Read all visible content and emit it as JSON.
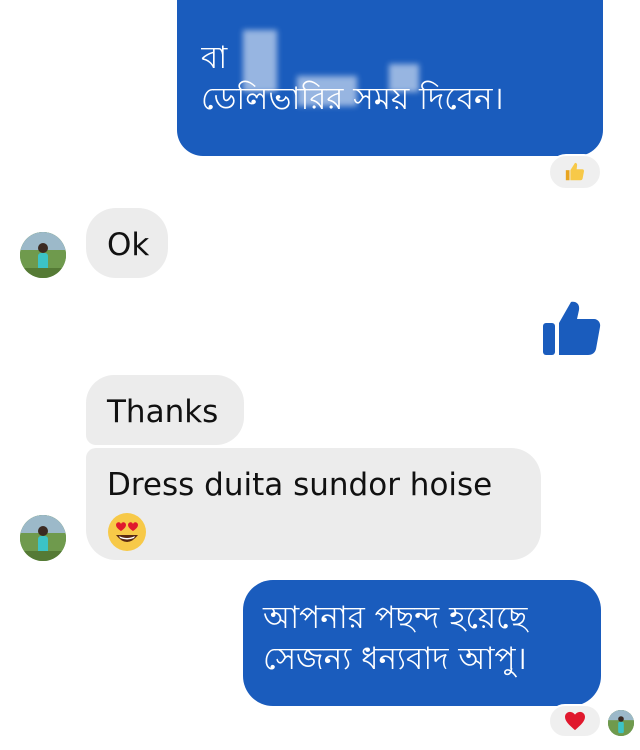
{
  "conversation": {
    "messages": [
      {
        "id": "msg-top",
        "direction": "outgoing",
        "lines": [
          "বা",
          "ডেলিভারির সময় দিবেন।"
        ],
        "partially_obscured": true,
        "reaction": "thumbs-up"
      },
      {
        "id": "msg-ok",
        "direction": "incoming",
        "text": "Ok"
      },
      {
        "id": "big-like",
        "direction": "outgoing",
        "sticker": "thumbs-up-sticker"
      },
      {
        "id": "msg-thanks",
        "direction": "incoming",
        "text": "Thanks"
      },
      {
        "id": "msg-dress",
        "direction": "incoming",
        "text": "Dress duita sundor hoise",
        "emoji": "heart-eyes-emoji"
      },
      {
        "id": "msg-thanks-reply",
        "direction": "outgoing",
        "lines": [
          "আপনার পছন্দ হয়েছে",
          "সেজন্য ধন্যবাদ আপু।"
        ],
        "reaction": "heart"
      }
    ]
  },
  "colors": {
    "outgoing_bubble": "#1a5cbd",
    "incoming_bubble": "#ececec",
    "like_blue": "#1a5cbd",
    "heart_red": "#e0182d",
    "emoji_yellow": "#f7c948"
  }
}
